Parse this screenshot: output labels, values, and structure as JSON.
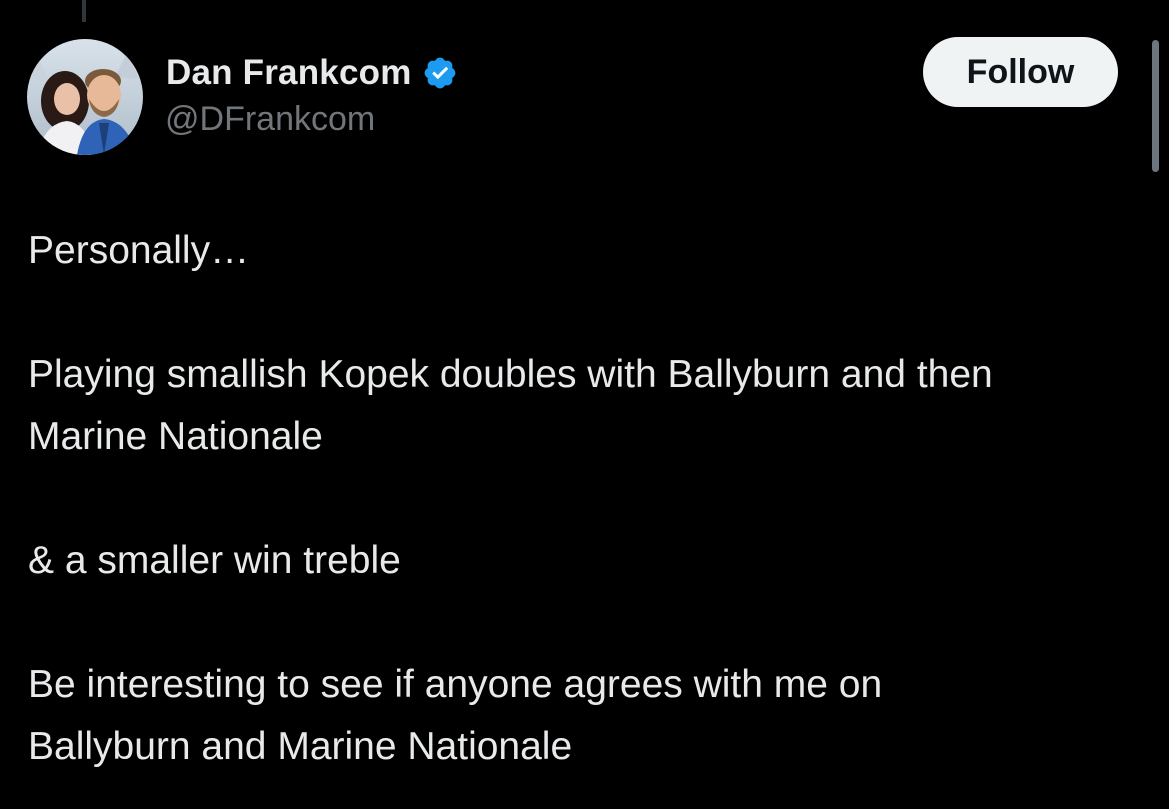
{
  "author": {
    "display_name": "Dan Frankcom",
    "handle": "@DFrankcom",
    "verified": true,
    "verified_icon": "verified-badge-icon",
    "verified_color": "#1d9bf0"
  },
  "follow_button": {
    "label": "Follow"
  },
  "tweet": {
    "paragraphs": [
      "Personally…",
      "Playing smallish Kopek doubles with Ballyburn and then Marine Nationale",
      "& a smaller win treble",
      "Be interesting to see if anyone agrees with me on Ballyburn and Marine Nationale"
    ]
  },
  "theme": {
    "background": "#000000",
    "text": "#e7e9ea",
    "secondary_text": "#71767b",
    "button_bg": "#eff3f4"
  }
}
